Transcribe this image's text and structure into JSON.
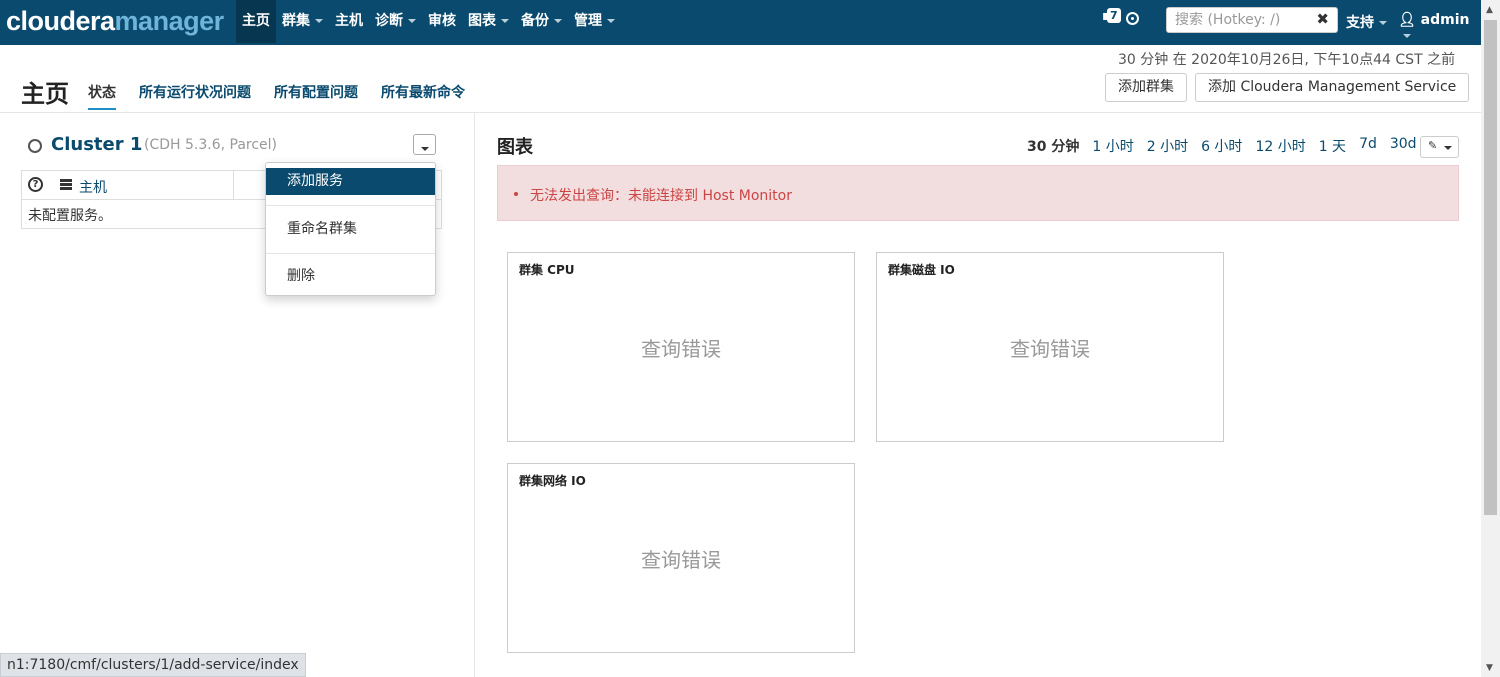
{
  "header": {
    "logo_left": "cloudera",
    "logo_right": "manager",
    "nav": [
      {
        "label": "主页",
        "active": true,
        "has_caret": false
      },
      {
        "label": "群集",
        "active": false,
        "has_caret": true
      },
      {
        "label": "主机",
        "active": false,
        "has_caret": false
      },
      {
        "label": "诊断",
        "active": false,
        "has_caret": true
      },
      {
        "label": "审核",
        "active": false,
        "has_caret": false
      },
      {
        "label": "图表",
        "active": false,
        "has_caret": true
      },
      {
        "label": "备份",
        "active": false,
        "has_caret": true
      },
      {
        "label": "管理",
        "active": false,
        "has_caret": true
      }
    ],
    "commands_badge": "7",
    "search_placeholder": "搜索 (Hotkey: /)",
    "search_clear": "✖",
    "support_label": "支持",
    "user_label": "admin",
    "user_icon": "user-icon"
  },
  "page": {
    "timestamp": "30 分钟 在 2020年10月26日, 下午10点44 CST 之前",
    "title": "主页",
    "tabs": [
      "状态",
      "所有运行状况问题",
      "所有配置问题",
      "所有最新命令"
    ],
    "add_cluster_label": "添加群集",
    "add_cms_label": "添加 Cloudera Management Service"
  },
  "cluster": {
    "name": "Cluster 1",
    "info": "(CDH 5.3.6, Parcel)",
    "hosts_link": "主机",
    "empty_text": "未配置服务。",
    "menu": [
      "添加服务",
      "重命名群集",
      "删除"
    ]
  },
  "charts": {
    "title": "图表",
    "ranges": [
      "30 分钟",
      "1 小时",
      "2 小时",
      "6 小时",
      "12 小时",
      "1 天",
      "7d",
      "30d"
    ],
    "active_range": "30 分钟",
    "alert_text": "无法发出查询：未能连接到 Host Monitor",
    "boxes": [
      {
        "title": "群集 CPU",
        "error": "查询错误"
      },
      {
        "title": "群集磁盘 IO",
        "error": "查询错误"
      },
      {
        "title": "群集网络 IO",
        "error": "查询错误"
      }
    ]
  },
  "status_bar": {
    "url": "n1:7180/cmf/clusters/1/add-service/index"
  }
}
